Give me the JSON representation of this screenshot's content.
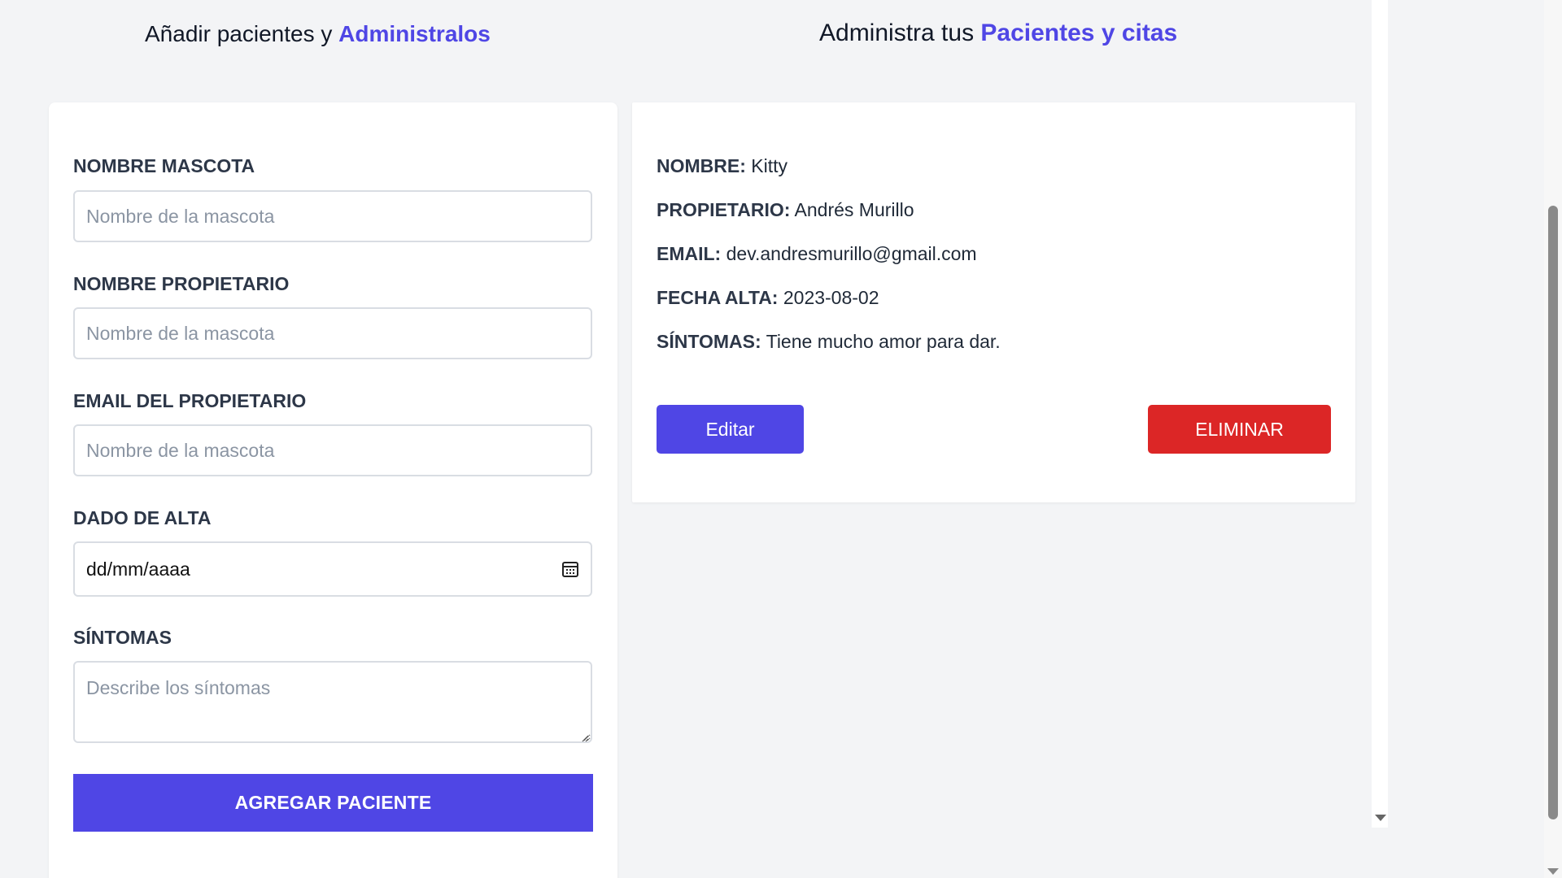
{
  "left_heading": {
    "prefix": "Añadir pacientes y ",
    "accent": "Administralos"
  },
  "right_heading": {
    "prefix": "Administra tus ",
    "accent": "Pacientes y citas"
  },
  "form": {
    "pet_name_label": "NOMBRE MASCOTA",
    "pet_name_placeholder": "Nombre de la mascota",
    "owner_name_label": "NOMBRE PROPIETARIO",
    "owner_name_placeholder": "Nombre de la mascota",
    "owner_email_label": "EMAIL DEL PROPIETARIO",
    "owner_email_placeholder": "Nombre de la mascota",
    "discharge_label": "DADO DE ALTA",
    "discharge_value": "dd/mm/aaaa",
    "symptoms_label": "SÍNTOMAS",
    "symptoms_placeholder": "Describe los síntomas",
    "submit_label": "AGREGAR PACIENTE"
  },
  "patient": {
    "name_key": "NOMBRE:",
    "name_value": "Kitty",
    "owner_key": "PROPIETARIO:",
    "owner_value": "Andrés Murillo",
    "email_key": "EMAIL:",
    "email_value": "dev.andresmurillo@gmail.com",
    "date_key": "FECHA ALTA:",
    "date_value": "2023-08-02",
    "symptoms_key": "SÍNTOMAS:",
    "symptoms_value": "Tiene mucho amor para dar.",
    "edit_label": "Editar",
    "delete_label": "ELIMINAR"
  },
  "icons": {
    "calendar": "calendar-icon",
    "resize": "resize-grip-icon"
  },
  "colors": {
    "accent": "#4f46e5",
    "danger": "#dc2626",
    "background": "#f3f4f6"
  }
}
